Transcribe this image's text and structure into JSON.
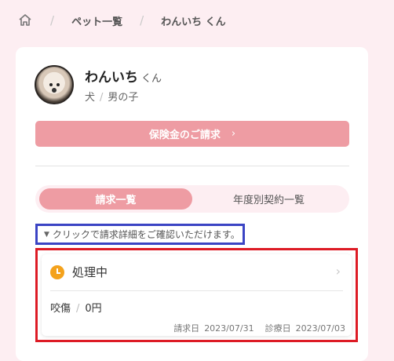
{
  "breadcrumb": {
    "home_icon": "home-icon",
    "items": [
      "ペット一覧",
      "わんいち くん"
    ]
  },
  "pet": {
    "name": "わんいち",
    "suffix": "くん",
    "species": "犬",
    "sex": "男の子"
  },
  "claim_button": {
    "label": "保険金のご請求",
    "chevron": "›"
  },
  "tabs": [
    {
      "label": "請求一覧",
      "active": true
    },
    {
      "label": "年度別契約一覧",
      "active": false
    }
  ],
  "hint": {
    "text": "クリックで請求詳細をご確認いただけます。"
  },
  "claims": [
    {
      "status": "処理中",
      "status_icon": "clock-icon",
      "status_color": "#f4a21c",
      "diagnosis": "咬傷",
      "amount": "0円",
      "claim_date_label": "請求日",
      "claim_date": "2023/07/31",
      "treatment_date_label": "診療日",
      "treatment_date": "2023/07/03"
    }
  ],
  "colors": {
    "accent": "#ee9ca3",
    "background": "#fdeef2",
    "highlight_blue": "#3b44c4",
    "highlight_red": "#dd1b25"
  }
}
